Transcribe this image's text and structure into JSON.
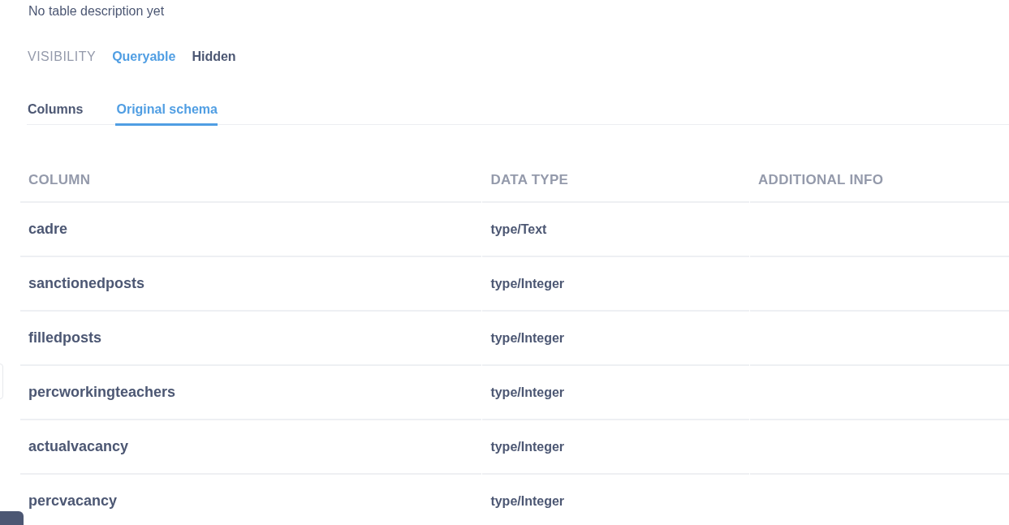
{
  "description": "No table description yet",
  "visibility": {
    "label": "VISIBILITY",
    "options": [
      {
        "label": "Queryable",
        "selected": true
      },
      {
        "label": "Hidden",
        "selected": false
      }
    ]
  },
  "tabs": [
    {
      "label": "Columns",
      "selected": false
    },
    {
      "label": "Original schema",
      "selected": true
    }
  ],
  "table": {
    "columns": [
      "COLUMN",
      "DATA TYPE",
      "ADDITIONAL INFO"
    ],
    "rows": [
      [
        "cadre",
        "type/Text"
      ],
      [
        "sanctionedposts",
        "type/Integer"
      ],
      [
        "filledposts",
        "type/Integer"
      ],
      [
        "percworkingteachers",
        "type/Integer"
      ],
      [
        "actualvacancy",
        "type/Integer"
      ],
      [
        "percvacancy",
        "type/Integer"
      ]
    ]
  }
}
